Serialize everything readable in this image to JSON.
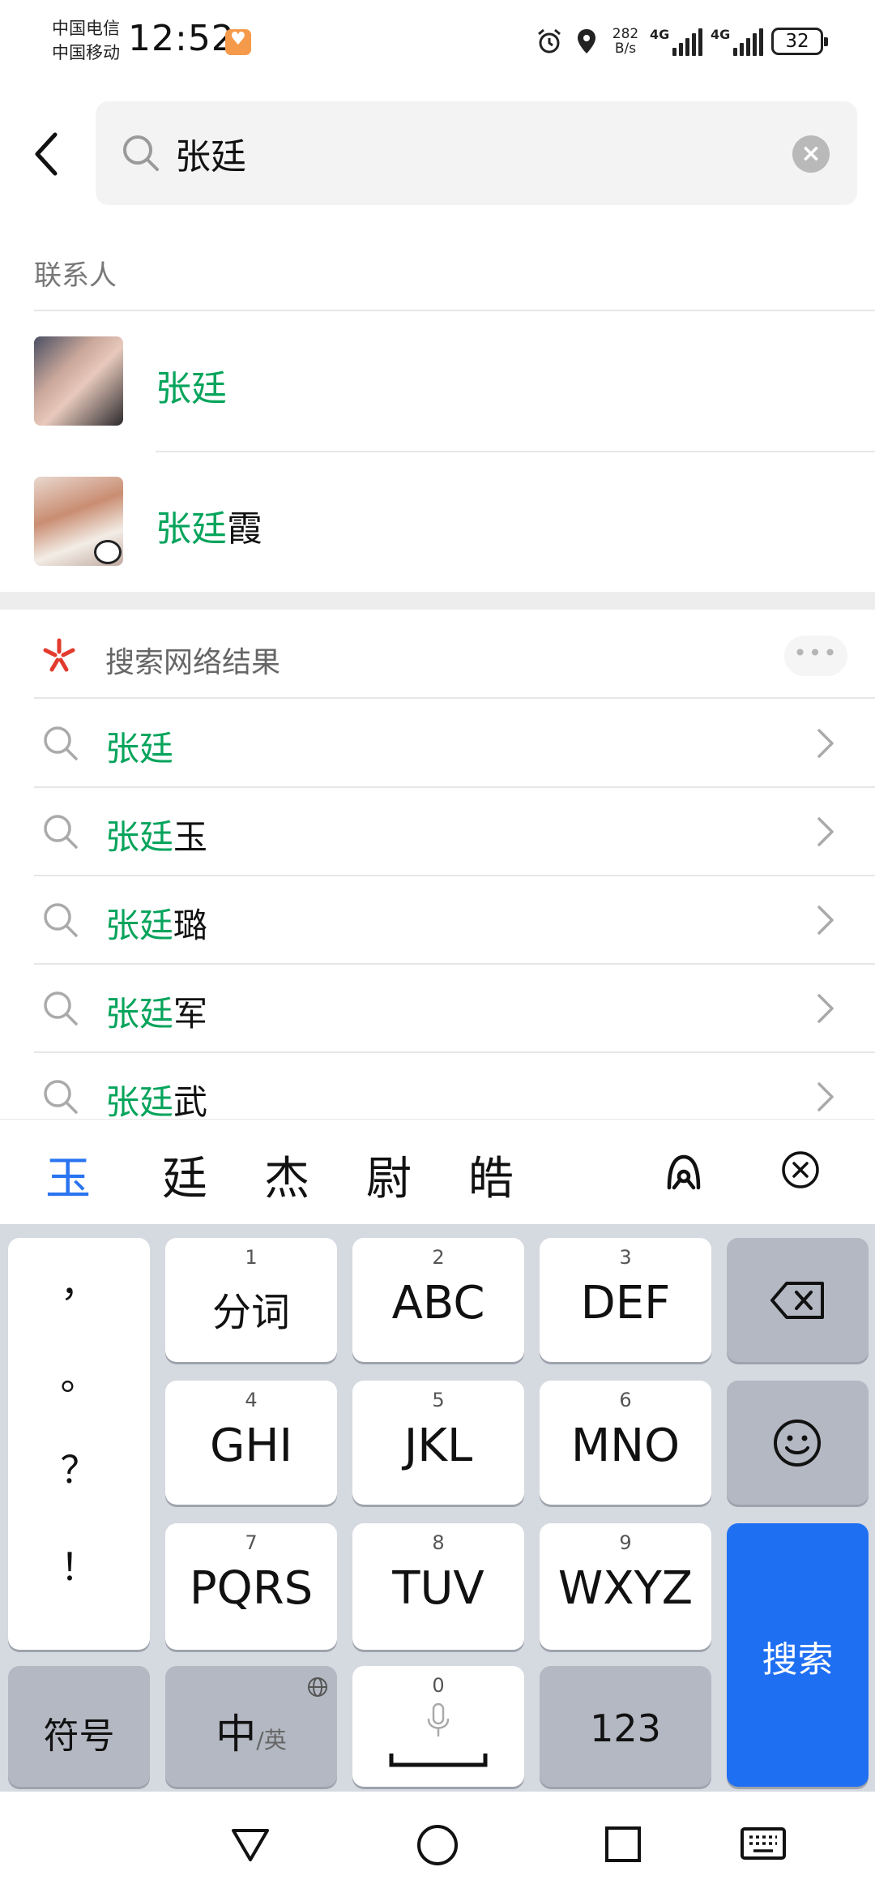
{
  "status_bar": {
    "carrier_1": "中国电信",
    "carrier_2": "中国移动",
    "time": "12:52",
    "net_speed_value": "282",
    "net_speed_unit": "B/s",
    "signal_1_label": "4G",
    "signal_2_label": "4G",
    "battery_level": "32"
  },
  "search": {
    "query": "张廷"
  },
  "contacts": {
    "section_label": "联系人",
    "items": [
      {
        "highlight": "张廷",
        "rest": ""
      },
      {
        "highlight": "张廷",
        "rest": "霞"
      }
    ]
  },
  "web_results": {
    "section_label": "搜索网络结果",
    "more_label": "•••",
    "items": [
      {
        "highlight": "张廷",
        "rest": ""
      },
      {
        "highlight": "张廷",
        "rest": "玉"
      },
      {
        "highlight": "张廷",
        "rest": "璐"
      },
      {
        "highlight": "张廷",
        "rest": "军"
      },
      {
        "highlight": "张廷",
        "rest": "武"
      }
    ]
  },
  "ime": {
    "candidates": [
      "玉",
      "廷",
      "杰",
      "尉",
      "皓"
    ],
    "punctuation": [
      "，",
      "。",
      "？",
      "！"
    ],
    "keys": {
      "k1": {
        "num": "1",
        "label": "分词"
      },
      "k2": {
        "num": "2",
        "label": "ABC"
      },
      "k3": {
        "num": "3",
        "label": "DEF"
      },
      "k4": {
        "num": "4",
        "label": "GHI"
      },
      "k5": {
        "num": "5",
        "label": "JKL"
      },
      "k6": {
        "num": "6",
        "label": "MNO"
      },
      "k7": {
        "num": "7",
        "label": "PQRS"
      },
      "k8": {
        "num": "8",
        "label": "TUV"
      },
      "k9": {
        "num": "9",
        "label": "WXYZ"
      },
      "k0": {
        "num": "0"
      }
    },
    "symbols_label": "符号",
    "lang_main": "中",
    "lang_alt": "/英",
    "numbers_label": "123",
    "search_label": "搜索"
  },
  "colors": {
    "highlight": "#07a45c",
    "candidate_active": "#2a74f0",
    "search_key": "#1f6ff2"
  }
}
